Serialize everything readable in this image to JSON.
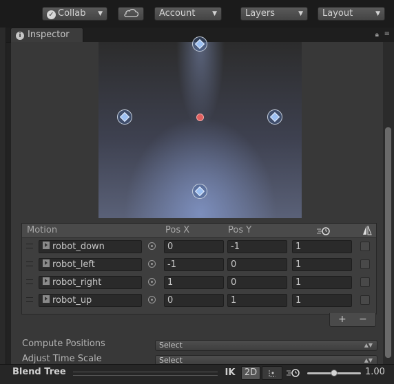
{
  "toolbar": {
    "collab_label": "Collab",
    "account_label": "Account",
    "layers_label": "Layers",
    "layout_label": "Layout",
    "cloud_icon": "cloud-icon"
  },
  "inspector": {
    "tab_label": "Inspector",
    "info_glyph": "i"
  },
  "motion_list": {
    "headers": {
      "motion": "Motion",
      "pos_x": "Pos X",
      "pos_y": "Pos Y"
    },
    "rows": [
      {
        "clip": "robot_down",
        "pos_x": "0",
        "pos_y": "-1",
        "speed": "1"
      },
      {
        "clip": "robot_left",
        "pos_x": "-1",
        "pos_y": "0",
        "speed": "1"
      },
      {
        "clip": "robot_right",
        "pos_x": "1",
        "pos_y": "0",
        "speed": "1"
      },
      {
        "clip": "robot_up",
        "pos_x": "0",
        "pos_y": "1",
        "speed": "1"
      }
    ],
    "add_glyph": "+",
    "remove_glyph": "−"
  },
  "properties": {
    "compute_positions_label": "Compute Positions",
    "compute_positions_value": "Select",
    "adjust_time_scale_label": "Adjust Time Scale",
    "adjust_time_scale_value": "Select"
  },
  "bottom_bar": {
    "title": "Blend Tree",
    "ik_label": "IK",
    "twod_label": "2D",
    "speed_value": "1.00",
    "speed_fraction": 0.5
  },
  "colors": {
    "accent_node": "#9cc0f2",
    "current_point": "#e0605f"
  }
}
